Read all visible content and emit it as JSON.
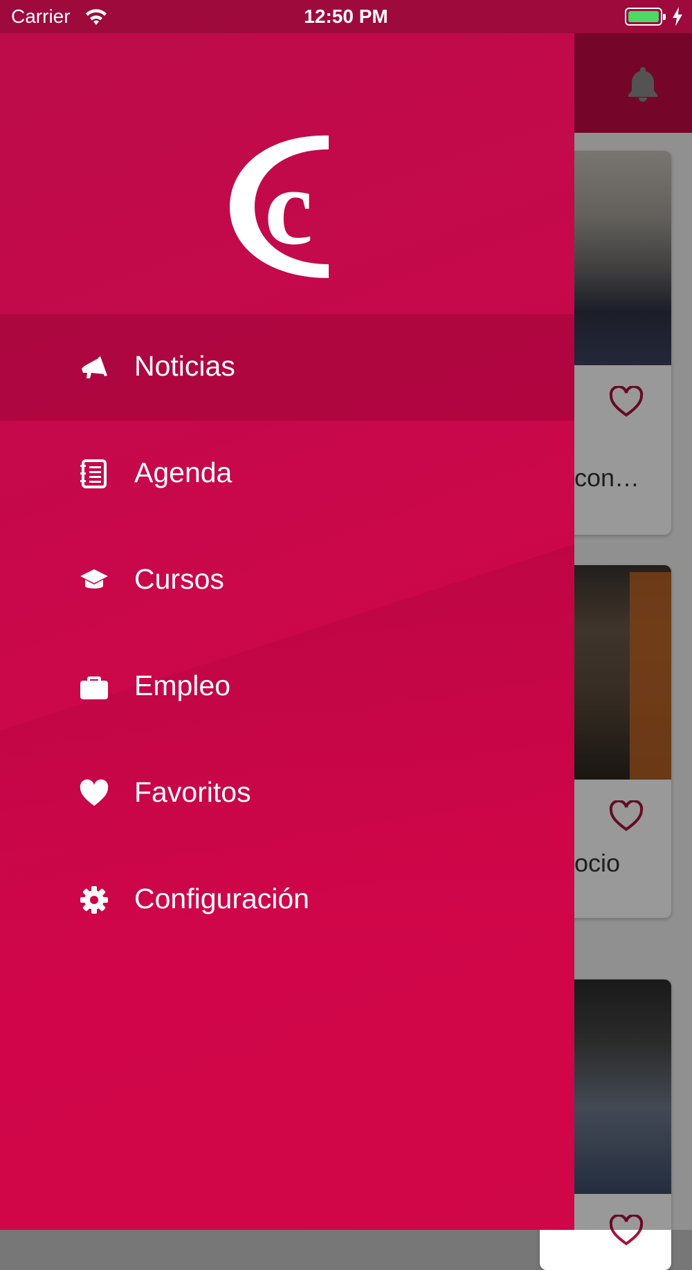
{
  "status_bar": {
    "carrier": "Carrier",
    "time": "12:50 PM"
  },
  "drawer": {
    "logo_icon": "c-monogram-logo",
    "items": [
      {
        "label": "Noticias",
        "icon": "megaphone-icon",
        "active": true
      },
      {
        "label": "Agenda",
        "icon": "agenda-icon",
        "active": false
      },
      {
        "label": "Cursos",
        "icon": "graduation-cap-icon",
        "active": false
      },
      {
        "label": "Empleo",
        "icon": "briefcase-icon",
        "active": false
      },
      {
        "label": "Favoritos",
        "icon": "heart-icon",
        "active": false
      },
      {
        "label": "Configuración",
        "icon": "gear-icon",
        "active": false
      }
    ]
  },
  "background": {
    "cards": [
      {
        "snippet": "con…"
      },
      {
        "snippet": "ocio"
      },
      {
        "snippet": ""
      }
    ]
  },
  "colors": {
    "brand": "#c8084a",
    "status_bar": "#9e0a3c",
    "heart_outline": "#a8133f",
    "battery": "#4cd964"
  }
}
